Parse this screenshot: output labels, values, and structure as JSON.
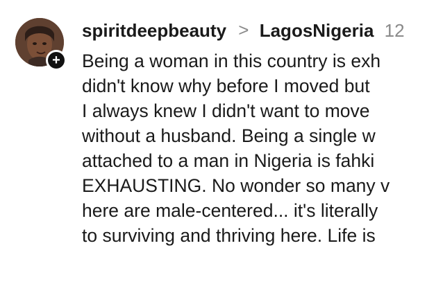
{
  "comment": {
    "username": "spiritdeepbeauty",
    "separator": ">",
    "reply_target": "LagosNigeria",
    "timestamp": "12",
    "follow_badge": "+",
    "lines": [
      "Being a woman in this country is exh",
      "didn't know why before I moved but",
      "I always knew I didn't want to move",
      "without a husband. Being a single w",
      "attached to a man in Nigeria is fahki",
      "EXHAUSTING. No wonder so many v",
      "here are male-centered... it's literally",
      "to surviving and thriving here. Life is"
    ]
  },
  "icons": {
    "avatar": "profile-avatar",
    "badge": "plus-icon"
  },
  "colors": {
    "text": "#1a1a1a",
    "muted": "#8a8a8a",
    "badge": "#111111"
  }
}
